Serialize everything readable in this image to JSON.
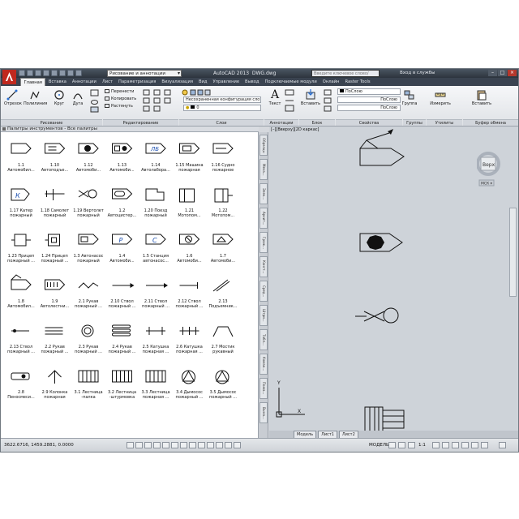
{
  "app": {
    "title": "AutoCAD 2013",
    "file": "DWG.dwg",
    "workspace": "Рисование и аннотации",
    "search_placeholder": "Введите ключевое слово/фразу",
    "login": "Вход в службы"
  },
  "colors": {
    "titlebar": "#2d343d",
    "ribbon": "#e6e8eb",
    "viewport": "#ced3d9",
    "logo": "#c0281e"
  },
  "ribbon_tabs": [
    "Главная",
    "Вставка",
    "Аннотации",
    "Лист",
    "Параметризация",
    "Визуализация",
    "Вид",
    "Управление",
    "Вывод",
    "Подключаемые модули",
    "Онлайн",
    "Raster Tools"
  ],
  "ribbon": {
    "draw": {
      "line": "Отрезок",
      "polyline": "Полилиния",
      "circle": "Круг",
      "arc": "Дуга"
    },
    "modify": {
      "move": "Перенести",
      "copy": "Копировать",
      "stretch": "Растянуть"
    },
    "layer_select": "Несохраненная конфигурация сло",
    "layer_value": "0",
    "text": "Текст",
    "insert": "Вставить",
    "prop1": "ПоСлою",
    "prop2": "ПоСлою",
    "prop3": "ПоСлою",
    "group": "Группа",
    "measure": "Измерить",
    "paste": "Вставить",
    "panels": {
      "draw": "Рисование",
      "modify": "Редактирование",
      "layers": "Слои",
      "annotation": "Аннотации",
      "block": "Блок",
      "properties": "Свойства",
      "groups": "Группы",
      "utilities": "Утилиты",
      "clipboard": "Буфер обмена"
    }
  },
  "palette": {
    "title": "Палитры инструментов - Все палитры",
    "items": [
      [
        "1.1",
        "Автомобил..."
      ],
      [
        "1.10",
        "Автоподъе..."
      ],
      [
        "1.12",
        "Автомоби..."
      ],
      [
        "1.13",
        "Автомоби..."
      ],
      [
        "1.14",
        "Автолабора..."
      ],
      [
        "1.15 Машина",
        "пожарная"
      ],
      [
        "1.16 Судно",
        "пожарное"
      ],
      [
        "1.17 Катер",
        "пожарный"
      ],
      [
        "1.18 Самолет",
        "пожарный"
      ],
      [
        "1.19 Вертолет",
        "пожарный"
      ],
      [
        "1.2",
        "Автоцистер..."
      ],
      [
        "1.20 Поезд",
        "пожарный"
      ],
      [
        "1.21",
        "Мотопом..."
      ],
      [
        "1.22",
        "Мотопом..."
      ],
      [
        "1.23 Прицеп",
        "пожарный ..."
      ],
      [
        "1.24 Прицеп",
        "пожарный ..."
      ],
      [
        "1.3 Автонасос",
        "пожарный"
      ],
      [
        "1.4",
        "Автомоби..."
      ],
      [
        "1.5 Станция",
        "автонасос..."
      ],
      [
        "1.6",
        "Автомоби..."
      ],
      [
        "1.7",
        "Автомоби..."
      ],
      [
        "1.8",
        "Автомобил..."
      ],
      [
        "1.9",
        "Автолестни..."
      ],
      [
        "2.1 Рукав",
        "пожарный ..."
      ],
      [
        "2.10 Ствол",
        "пожарный ..."
      ],
      [
        "2.11 Ствол",
        "пожарный ..."
      ],
      [
        "2.12 Ствол",
        "пожарный ..."
      ],
      [
        "2.13",
        "Подъемник..."
      ],
      [
        "2.13 Ствол",
        "пожарный ..."
      ],
      [
        "2.2 Рукав",
        "пожарный ..."
      ],
      [
        "2.3 Рукав",
        "пожарный ..."
      ],
      [
        "2.4 Рукав",
        "пожарный ..."
      ],
      [
        "2.5 Катушка",
        "пожарная ..."
      ],
      [
        "2.6 Катушка",
        "пожарная ..."
      ],
      [
        "2.7 Мостик",
        "рукавный"
      ],
      [
        "2.8",
        "Пеносмеси..."
      ],
      [
        "2.9 Колонка",
        "пожарная"
      ],
      [
        "3.1 Лестница",
        "-палка"
      ],
      [
        "3.2 Лестница",
        "-штурмовка"
      ],
      [
        "3.3 Лестница",
        "пожарная ..."
      ],
      [
        "3.4 Дымосос",
        "пожарный ..."
      ],
      [
        "3.5 Дымосос",
        "пожарный ..."
      ]
    ]
  },
  "side_tabs": [
    "Образцы",
    "Меха...",
    "Элек...",
    "Архит...",
    "Граж...",
    "Конст...",
    "Сред...",
    "Штри...",
    "Табл...",
    "Коман...",
    "Пожа...",
    "Выно..."
  ],
  "viewport": {
    "label": "[–][Вверху][2D каркас]",
    "view_cube": "Верх",
    "ucs": "МСК ▾",
    "ucs_y": "Y",
    "ucs_x": "X"
  },
  "model_tabs": [
    "Модель",
    "Лист1",
    "Лист2"
  ],
  "status": {
    "coords": "3622.6716, 1459.2881, 0.0000",
    "model": "МОДЕЛЬ",
    "scale": "1:1"
  }
}
